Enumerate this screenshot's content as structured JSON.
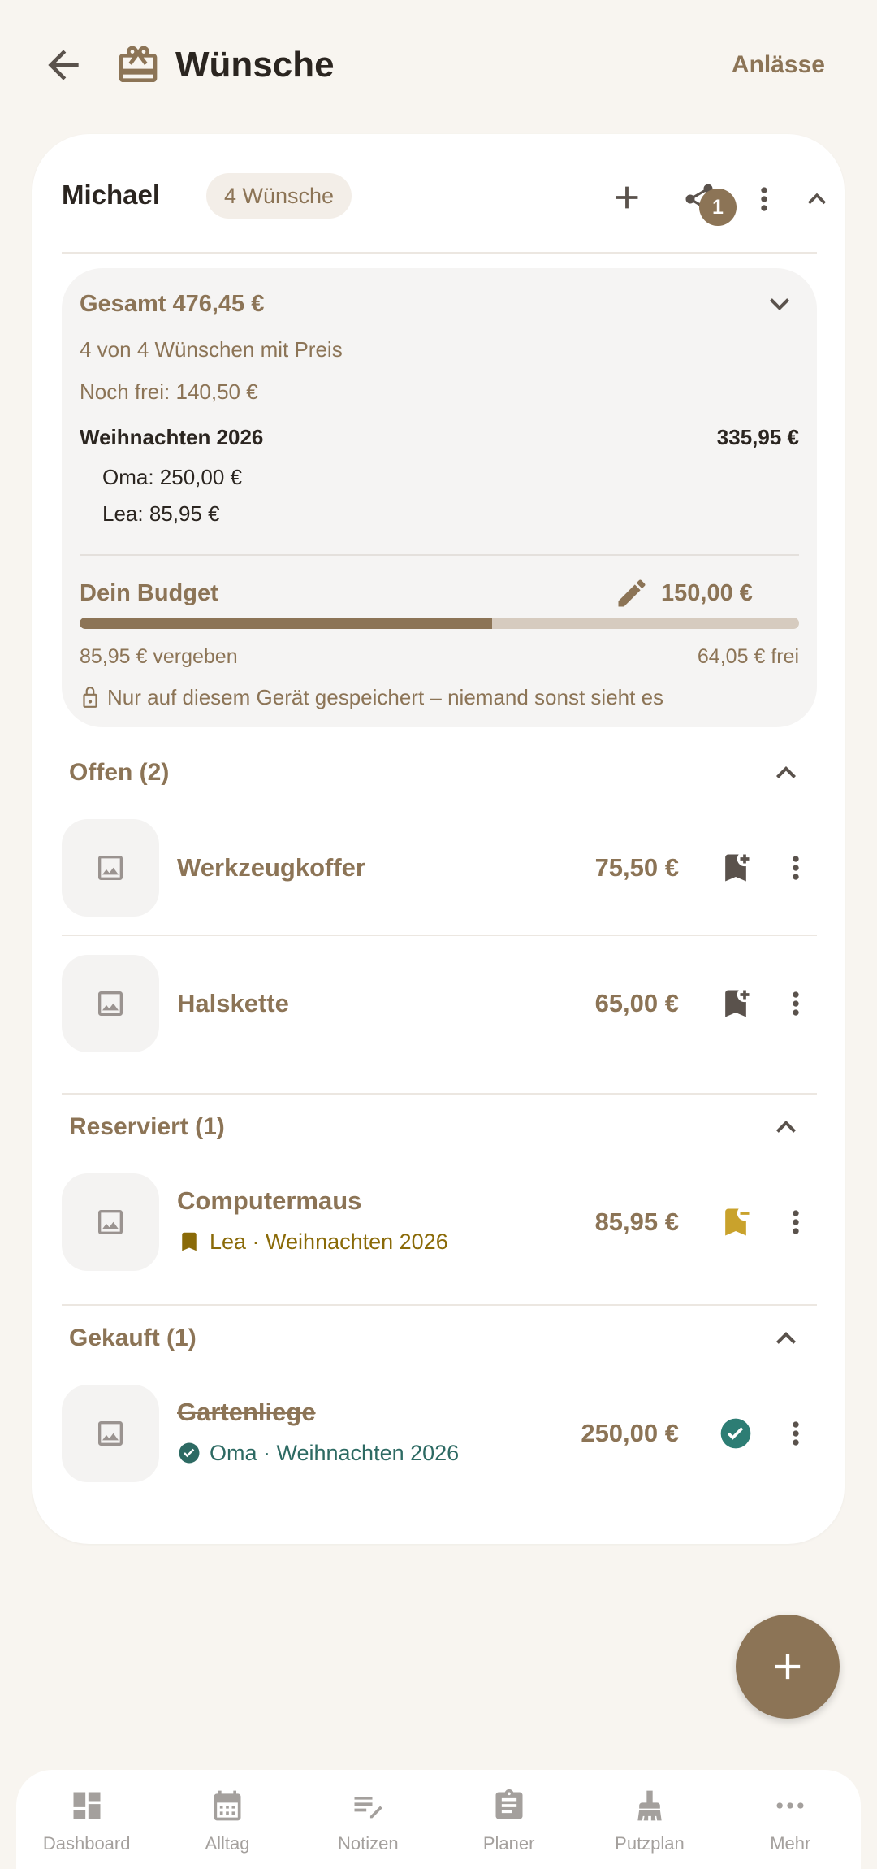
{
  "header": {
    "title": "Wünsche",
    "anlass_label": "Anlässe"
  },
  "person": {
    "name": "Michael",
    "count_label": "4 Wünsche",
    "share_badge": "1"
  },
  "summary": {
    "total": "Gesamt 476,45 €",
    "with_price": "4 von 4 Wünschen mit Preis",
    "remaining": "Noch frei: 140,50 €",
    "occasion": {
      "name": "Weihnachten 2026",
      "amount": "335,95 €",
      "entries": [
        "Oma: 250,00 €",
        "Lea: 85,95 €"
      ]
    },
    "budget_label": "Dein Budget",
    "budget_amount": "150,00 €",
    "budget_used_fraction": 0.573,
    "given": "85,95 € vergeben",
    "free": "64,05 € frei",
    "privacy_note": "Nur auf diesem Gerät gespeichert – niemand sonst sieht es"
  },
  "sections": [
    {
      "title": "Offen (2)",
      "items": [
        {
          "name": "Werkzeugkoffer",
          "price": "75,50 €",
          "action_icon": "bookmark-add-icon"
        },
        {
          "name": "Halskette",
          "price": "65,00 €",
          "action_icon": "bookmark-add-icon"
        }
      ]
    },
    {
      "title": "Reserviert (1)",
      "items": [
        {
          "name": "Computermaus",
          "price": "85,95 €",
          "sub": "Lea · Weihnachten 2026",
          "action_icon": "bookmark-remove-icon"
        }
      ]
    },
    {
      "title": "Gekauft (1)",
      "items": [
        {
          "name": "Gartenliege",
          "price": "250,00 €",
          "sub": "Oma · Weihnachten 2026",
          "action_icon": "check-circle-icon"
        }
      ]
    }
  ],
  "nav": [
    {
      "label": "Dashboard",
      "icon": "dashboard-icon"
    },
    {
      "label": "Alltag",
      "icon": "calendar-icon"
    },
    {
      "label": "Notizen",
      "icon": "notes-icon"
    },
    {
      "label": "Planer",
      "icon": "clipboard-icon"
    },
    {
      "label": "Putzplan",
      "icon": "broom-icon"
    },
    {
      "label": "Mehr",
      "icon": "more-horizontal-icon"
    }
  ],
  "colors": {
    "accent": "#8c7456",
    "reserved": "#c9a22c",
    "bought": "#2d6a63",
    "background": "#f8f5f0"
  }
}
